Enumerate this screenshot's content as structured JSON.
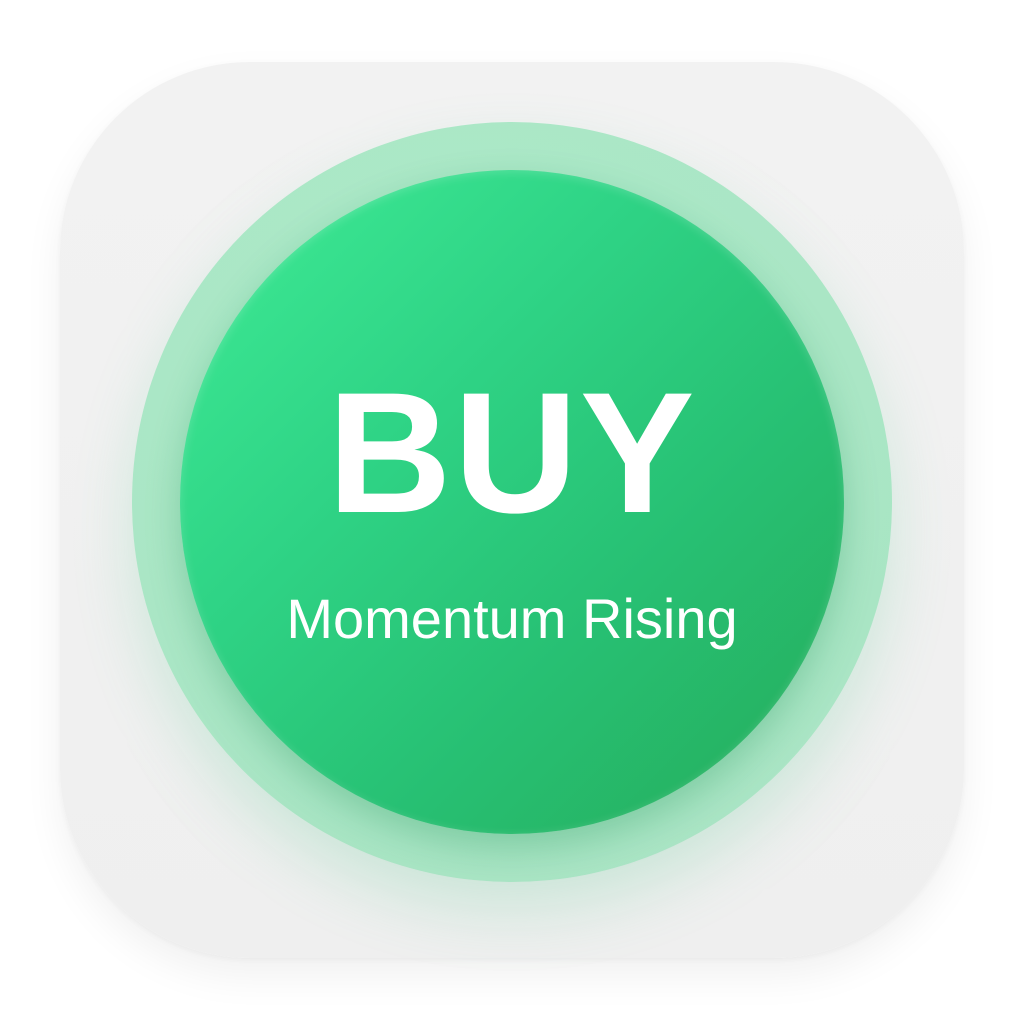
{
  "button": {
    "label": "BUY",
    "subtitle": "Momentum Rising"
  },
  "colors": {
    "tile_background": "#f0f0f0",
    "button_gradient_start": "#3fec96",
    "button_gradient_end": "#26ac5a",
    "halo": "#8fe6b8",
    "text": "#ffffff"
  }
}
